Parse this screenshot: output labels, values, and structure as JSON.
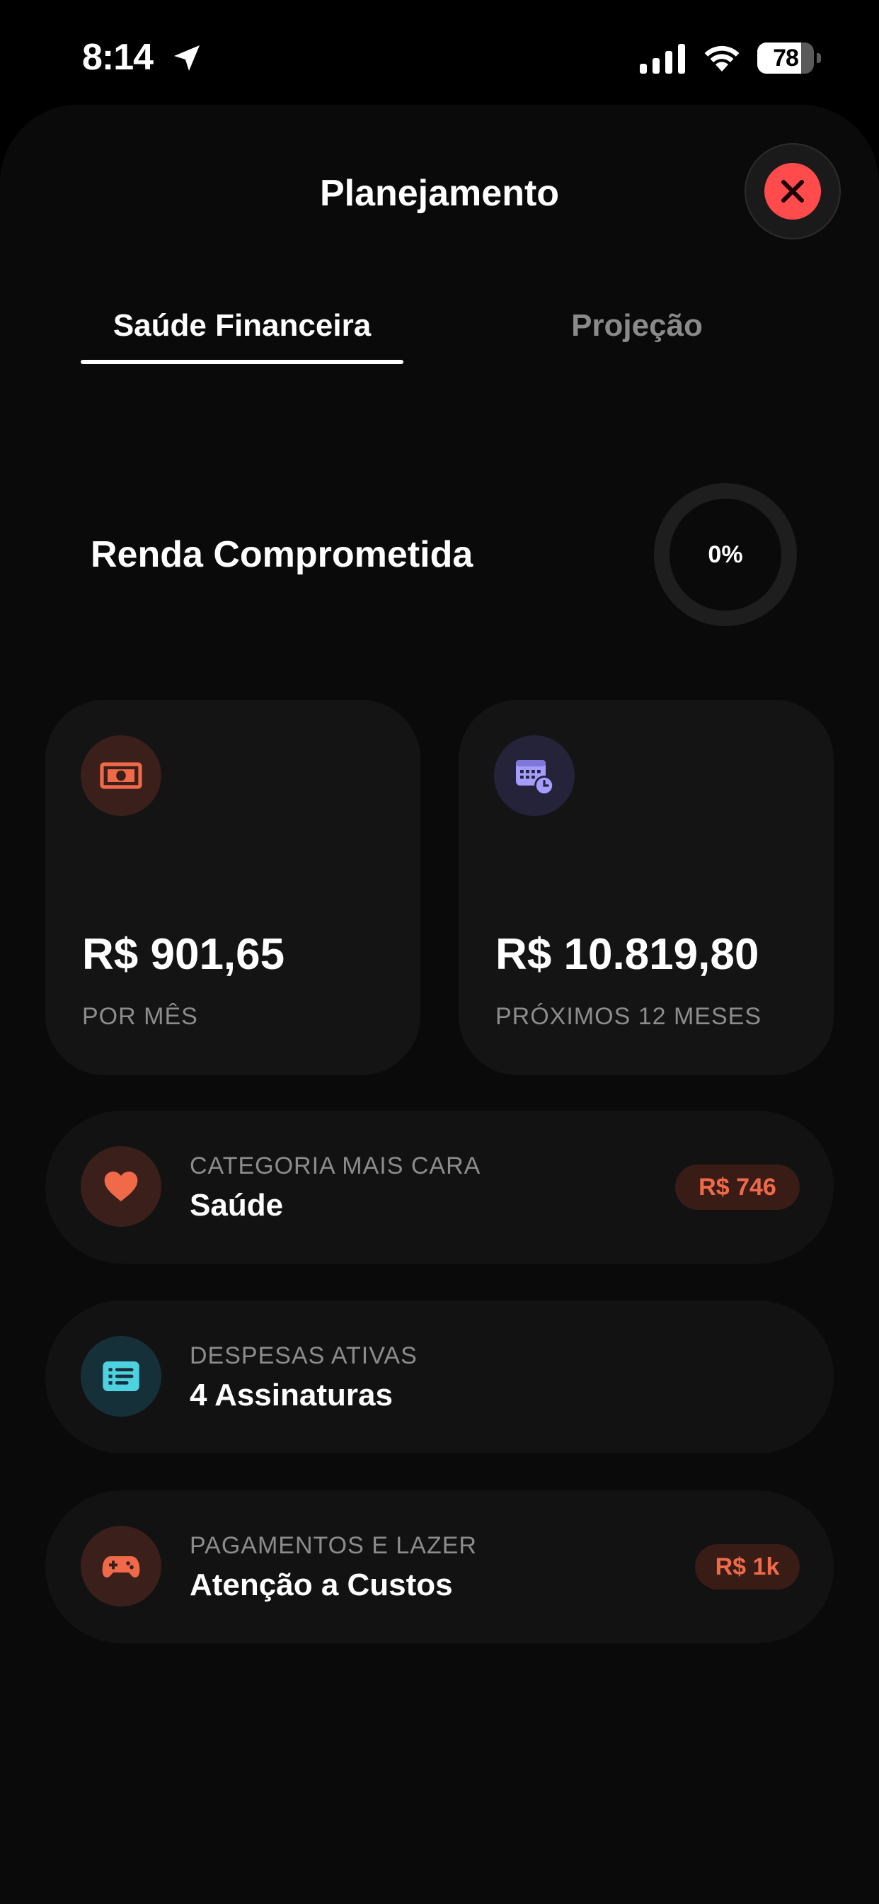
{
  "status_bar": {
    "time": "8:14",
    "battery_level": "78",
    "battery_fraction": 0.78,
    "icons": [
      "location-arrow-icon",
      "cellular-signal-icon",
      "wifi-icon",
      "battery-icon"
    ]
  },
  "header": {
    "title": "Planejamento",
    "close_icon": "close-icon"
  },
  "tabs": [
    {
      "label": "Saúde Financeira",
      "active": true
    },
    {
      "label": "Projeção",
      "active": false
    }
  ],
  "committed_income": {
    "title": "Renda Comprometida",
    "percent_label": "0%",
    "percent_value": 0
  },
  "stat_cards": {
    "monthly": {
      "icon": "banknote-icon",
      "value": "R$ 901,65",
      "label": "POR MÊS"
    },
    "annual": {
      "icon": "calendar-clock-icon",
      "value": "R$ 10.819,80",
      "label": "PRÓXIMOS 12 MESES"
    }
  },
  "rows": {
    "most_expensive": {
      "icon": "heart-icon",
      "label": "CATEGORIA MAIS CARA",
      "value": "Saúde",
      "badge": "R$ 746"
    },
    "active_expenses": {
      "icon": "list-icon",
      "label": "DESPESAS ATIVAS",
      "value": "4 Assinaturas"
    },
    "payments_leisure": {
      "icon": "gamepad-icon",
      "label": "PAGAMENTOS E LAZER",
      "value": "Atenção a Custos",
      "badge": "R$ 1k"
    }
  },
  "colors": {
    "background": "#0a0a0a",
    "card": "#141414",
    "close_red": "#ff4b4b",
    "accent_orange": "#f06a4a",
    "accent_purple": "#a59cff",
    "accent_teal": "#4fd2e0",
    "muted_text": "#8c8c8c"
  }
}
